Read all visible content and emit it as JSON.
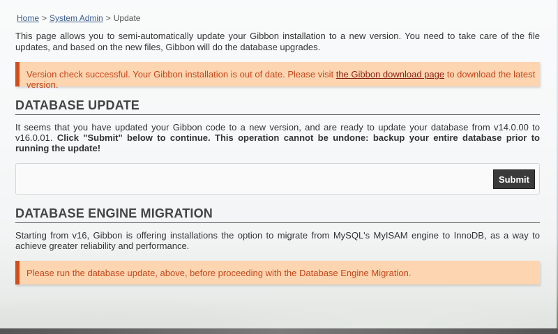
{
  "breadcrumb": {
    "home": "Home",
    "separator": ">",
    "system_admin": "System Admin",
    "current": "Update"
  },
  "intro": "This page allows you to semi-automatically update your Gibbon installation to a new version. You need to take care of the file updates, and based on the new files, Gibbon will do the database upgrades.",
  "version_alert": {
    "before": "Version check successful. Your Gibbon installation is out of date. Please visit ",
    "link": "the Gibbon download page",
    "after": " to download the latest version."
  },
  "database_update": {
    "title": "DATABASE UPDATE",
    "text_normal": "It seems that you have updated your Gibbon code to a new version, and are ready to update your database from v14.0.00 to v16.0.01. ",
    "text_bold": "Click \"Submit\" below to continue. This operation cannot be undone: backup your entire database prior to running the update!",
    "submit_label": "Submit"
  },
  "engine_migration": {
    "title": "DATABASE ENGINE MIGRATION",
    "text": "Starting from v16, Gibbon is offering installations the option to migrate from MySQL's MyISAM engine to InnoDB, as a way to achieve greater reliability and performance.",
    "alert": "Please run the database update, above, before proceeding with the Database Engine Migration."
  },
  "colors": {
    "warning_bg": "#fdd5b1",
    "warning_border": "#d14d1a",
    "warning_text": "#c4481a",
    "link": "#3b5e8c",
    "button_bg": "#3a3a3a"
  }
}
